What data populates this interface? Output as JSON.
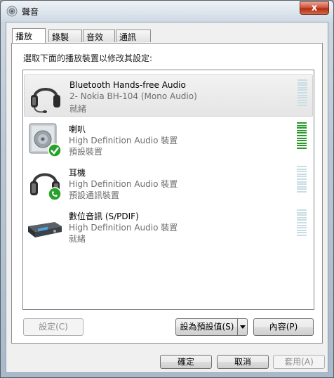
{
  "window": {
    "title": "聲音",
    "close_label": "x"
  },
  "tabs": [
    {
      "label": "播放",
      "active": true
    },
    {
      "label": "錄製",
      "active": false
    },
    {
      "label": "音效",
      "active": false
    },
    {
      "label": "通訊",
      "active": false
    }
  ],
  "instruction": "選取下面的播放裝置以修改其設定:",
  "devices": [
    {
      "name": "Bluetooth Hands-free Audio",
      "description": "2- Nokia BH-104 (Mono Audio)",
      "status": "就緒",
      "icon": "headset-icon",
      "selected": true,
      "level": 0.0
    },
    {
      "name": "喇叭",
      "description": "High Definition Audio 裝置",
      "status": "預設裝置",
      "icon": "speaker-icon",
      "badge": "check-badge-icon",
      "selected": false,
      "level": 1.0
    },
    {
      "name": "耳機",
      "description": "High Definition Audio 裝置",
      "status": "預設通訊裝置",
      "icon": "headphones-icon",
      "badge": "phone-badge-icon",
      "selected": false,
      "level": 0.0
    },
    {
      "name": "數位音訊 (S/PDIF)",
      "description": "High Definition Audio 裝置",
      "status": "就緒",
      "icon": "digital-audio-device-icon",
      "selected": false,
      "level": 0.0
    }
  ],
  "buttons": {
    "configure": "設定(C)",
    "set_default": "設為預設值(S)",
    "properties": "內容(P)",
    "ok": "確定",
    "cancel": "取消",
    "apply": "套用(A)"
  },
  "colors": {
    "meter_active": "#2a9b2a",
    "meter_inactive": "#c8dde4",
    "selected_row": "#e9e9e9"
  }
}
